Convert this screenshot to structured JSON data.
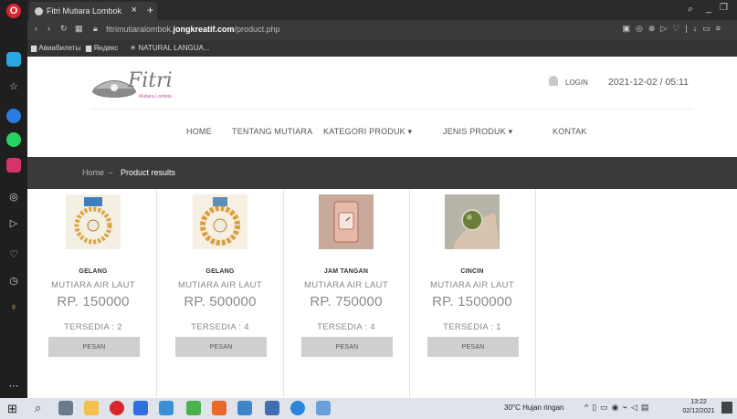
{
  "browser": {
    "tab_title": "Fitri Mutiara Lombok",
    "tab_close": "×",
    "new_tab": "+",
    "address": {
      "prefix": "fitrimutiaralombok.",
      "domain": "jongkreatif.com",
      "path": "/product.php"
    },
    "bookmarks": [
      "Авиабилеты",
      "Яндекс",
      "NATURAL LANGUA..."
    ]
  },
  "site": {
    "logo_text": "Fitri",
    "logo_sub": "Mutiara Lombok",
    "login_label": "LOGIN",
    "datetime": "2021-12-02 / 05:11",
    "nav": [
      {
        "label": "HOME"
      },
      {
        "label": "TENTANG MUTIARA"
      },
      {
        "label": "KATEGORI PRODUK ▾"
      },
      {
        "label": "JENIS PRODUK ▾"
      },
      {
        "label": "KONTAK"
      }
    ],
    "breadcrumb": {
      "home": "Home",
      "arrow": "→",
      "current": "Product results"
    }
  },
  "products": [
    {
      "category": "GELANG",
      "subtitle": "MUTIARA AIR LAUT",
      "price": "RP. 150000",
      "stock": "TERSEDIA : 2",
      "button": "PESAN"
    },
    {
      "category": "GELANG",
      "subtitle": "MUTIARA AIR LAUT",
      "price": "RP. 500000",
      "stock": "TERSEDIA : 4",
      "button": "PESAN"
    },
    {
      "category": "JAM TANGAN",
      "subtitle": "MUTIARA AIR LAUT",
      "price": "RP. 750000",
      "stock": "TERSEDIA : 4",
      "button": "PESAN"
    },
    {
      "category": "CINCIN",
      "subtitle": "MUTIARA AIR LAUT",
      "price": "RP. 1500000",
      "stock": "TERSEDIA : 1",
      "button": "PESAN"
    }
  ],
  "taskbar": {
    "weather": "30°C Hujan ringan",
    "time": "13:22",
    "date": "02/12/2021"
  },
  "colors": {
    "crumb_bg": "#3a3a3a",
    "button_bg": "#cfcfcf",
    "browser_dark": "#2b2b2b"
  }
}
